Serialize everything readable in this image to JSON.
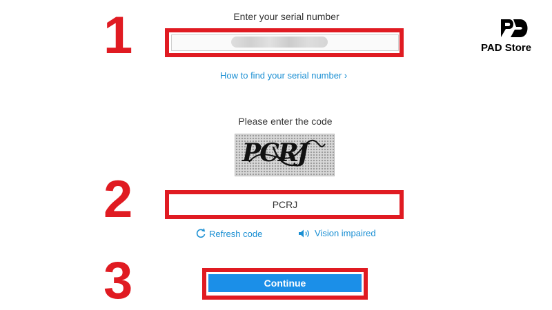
{
  "step_numbers": [
    "1",
    "2",
    "3"
  ],
  "serial": {
    "label": "Enter your serial number",
    "value": "",
    "help_link": "How to find your serial number ›"
  },
  "captcha": {
    "label": "Please enter the code",
    "image_text": "PCRJ",
    "input_value": "PCRJ",
    "refresh_label": "Refresh code",
    "vision_label": "Vision impaired"
  },
  "actions": {
    "continue_label": "Continue"
  },
  "brand": {
    "name": "PAD Store"
  },
  "colors": {
    "highlight_red": "#e01b22",
    "link_blue": "#1a8fd3",
    "button_blue": "#1b8fe8"
  }
}
